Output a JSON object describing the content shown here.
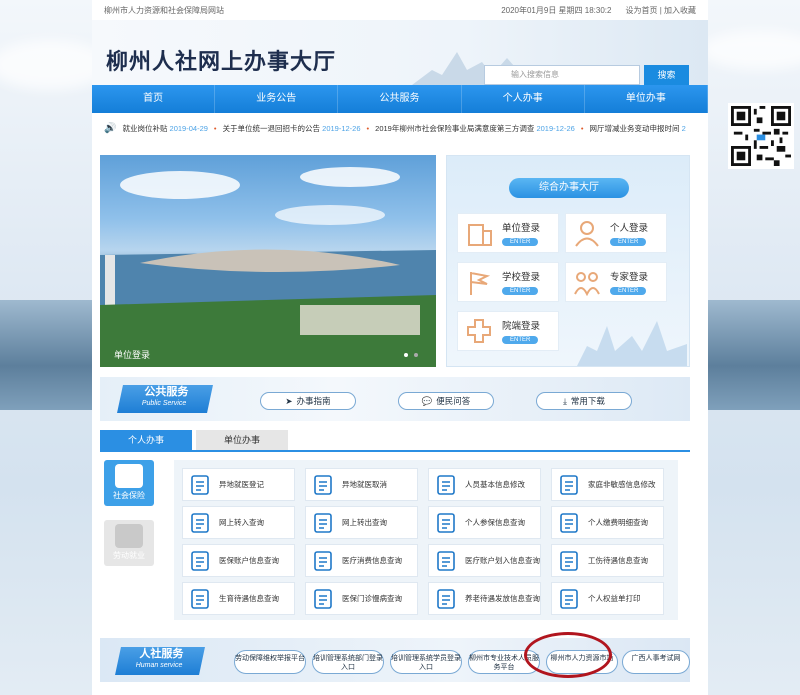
{
  "topbar": {
    "site": "柳州市人力资源和社会保障局网站",
    "datetime": "2020年01月9日 星期四 18:30:2",
    "set_home": "设为首页",
    "add_fav": "加入收藏"
  },
  "header": {
    "title": "柳州人社网上办事大厅",
    "search_placeholder": "输入搜索信息",
    "search_btn": "搜索"
  },
  "nav": [
    "首页",
    "业务公告",
    "公共服务",
    "个人办事",
    "单位办事"
  ],
  "ticker": [
    {
      "text": "就业岗位补贴",
      "date": "2019-04-29"
    },
    {
      "text": "关于单位统一退回招卡的公告",
      "date": "2019-12-26"
    },
    {
      "text": "2019年柳州市社会保险事业局满意度第三方调查",
      "date": "2019-12-26"
    },
    {
      "text": "网厅增减业务变动申报时间",
      "date": "2"
    }
  ],
  "hero": {
    "caption": "单位登录"
  },
  "hall": {
    "title": "综合办事大厅",
    "enter": "ENTER",
    "tiles": [
      "单位登录",
      "个人登录",
      "学校登录",
      "专家登录",
      "院端登录"
    ]
  },
  "public_service": {
    "zh": "公共服务",
    "en": "Public Service",
    "buttons": [
      "办事指南",
      "便民问答",
      "常用下载"
    ]
  },
  "tabs": [
    "个人办事",
    "单位办事"
  ],
  "side": [
    "社会保险",
    "劳动就业"
  ],
  "services": [
    "异地就医登记",
    "异地就医取消",
    "人员基本信息修改",
    "家庭非敏感信息修改",
    "网上转入查询",
    "网上转出查询",
    "个人参保信息查询",
    "个人缴费明细查询",
    "医保账户信息查询",
    "医疗消费信息查询",
    "医疗账户划入信息查询",
    "工伤待遇信息查询",
    "生育待遇信息查询",
    "医保门诊慢病查询",
    "养老待遇发放信息查询",
    "个人权益单打印"
  ],
  "hr_service": {
    "zh": "人社服务",
    "en": "Human service",
    "buttons": [
      "劳动保障维权举报平台",
      "培训管理系统部门登录入口",
      "培训管理系统学员登录入口",
      "柳州市专业技术人员服务平台",
      "柳州市人力资源市场",
      "广西人事考试网"
    ]
  },
  "colors": {
    "primary": "#1a8be0",
    "highlight": "#b1151e"
  }
}
